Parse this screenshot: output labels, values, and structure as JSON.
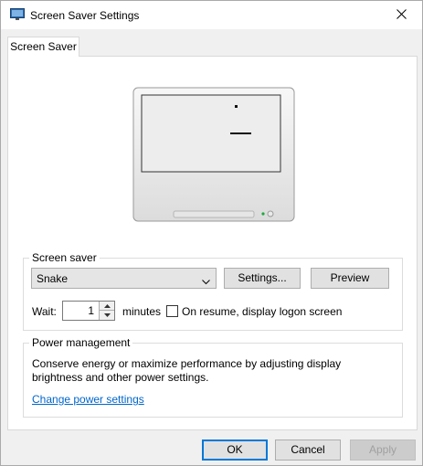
{
  "window": {
    "title": "Screen Saver Settings"
  },
  "tabs": [
    {
      "label": "Screen Saver"
    }
  ],
  "screen_saver_group": {
    "label": "Screen saver",
    "selected": "Snake",
    "settings_button": "Settings...",
    "preview_button": "Preview",
    "wait_label": "Wait:",
    "wait_value": "1",
    "minutes_label": "minutes",
    "resume_checkbox_label": "On resume, display logon screen",
    "resume_checked": false
  },
  "power_group": {
    "label": "Power management",
    "description_line1": "Conserve energy or maximize performance by adjusting display",
    "description_line2": "brightness and other power settings.",
    "link": "Change power settings"
  },
  "footer": {
    "ok": "OK",
    "cancel": "Cancel",
    "apply": "Apply"
  },
  "colors": {
    "accent": "#0078d7",
    "link": "#0066cc"
  },
  "icons": {
    "app": "display-settings-icon",
    "close": "close-icon",
    "dropdown": "chevron-down-icon"
  }
}
